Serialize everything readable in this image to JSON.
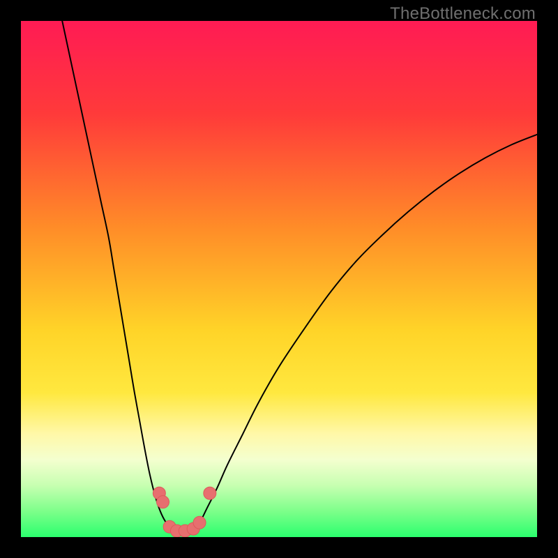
{
  "watermark": "TheBottleneck.com",
  "chart_data": {
    "type": "line",
    "title": "",
    "xlabel": "",
    "ylabel": "",
    "xlim": [
      0,
      100
    ],
    "ylim": [
      0,
      100
    ],
    "gradient_stops": [
      {
        "offset": 0.0,
        "color": "#ff1b54"
      },
      {
        "offset": 0.18,
        "color": "#ff3a3a"
      },
      {
        "offset": 0.4,
        "color": "#ff8c28"
      },
      {
        "offset": 0.6,
        "color": "#ffd428"
      },
      {
        "offset": 0.72,
        "color": "#ffe83f"
      },
      {
        "offset": 0.8,
        "color": "#fff8a8"
      },
      {
        "offset": 0.85,
        "color": "#f4ffcf"
      },
      {
        "offset": 0.9,
        "color": "#c7ffb1"
      },
      {
        "offset": 0.95,
        "color": "#7dff8a"
      },
      {
        "offset": 1.0,
        "color": "#2bff6e"
      }
    ],
    "series": [
      {
        "name": "left-curve",
        "stroke": "#000000",
        "stroke_width": 2,
        "points": [
          {
            "x": 8.0,
            "y": 100.0
          },
          {
            "x": 9.5,
            "y": 93.0
          },
          {
            "x": 11.0,
            "y": 86.0
          },
          {
            "x": 12.5,
            "y": 79.0
          },
          {
            "x": 14.0,
            "y": 72.0
          },
          {
            "x": 15.5,
            "y": 65.0
          },
          {
            "x": 17.0,
            "y": 58.0
          },
          {
            "x": 18.0,
            "y": 52.0
          },
          {
            "x": 19.0,
            "y": 46.0
          },
          {
            "x": 20.0,
            "y": 40.0
          },
          {
            "x": 21.0,
            "y": 34.0
          },
          {
            "x": 22.0,
            "y": 28.0
          },
          {
            "x": 23.0,
            "y": 22.5
          },
          {
            "x": 24.0,
            "y": 17.0
          },
          {
            "x": 25.0,
            "y": 12.0
          },
          {
            "x": 26.0,
            "y": 8.0
          },
          {
            "x": 27.0,
            "y": 5.0
          },
          {
            "x": 28.0,
            "y": 3.0
          },
          {
            "x": 29.0,
            "y": 1.8
          },
          {
            "x": 30.0,
            "y": 1.2
          }
        ]
      },
      {
        "name": "right-curve",
        "stroke": "#000000",
        "stroke_width": 2,
        "points": [
          {
            "x": 33.0,
            "y": 1.2
          },
          {
            "x": 34.0,
            "y": 2.0
          },
          {
            "x": 35.0,
            "y": 3.5
          },
          {
            "x": 36.0,
            "y": 5.5
          },
          {
            "x": 38.0,
            "y": 9.5
          },
          {
            "x": 40.0,
            "y": 14.0
          },
          {
            "x": 43.0,
            "y": 20.0
          },
          {
            "x": 46.0,
            "y": 26.0
          },
          {
            "x": 50.0,
            "y": 33.0
          },
          {
            "x": 55.0,
            "y": 40.5
          },
          {
            "x": 60.0,
            "y": 47.5
          },
          {
            "x": 65.0,
            "y": 53.5
          },
          {
            "x": 70.0,
            "y": 58.5
          },
          {
            "x": 75.0,
            "y": 63.0
          },
          {
            "x": 80.0,
            "y": 67.0
          },
          {
            "x": 85.0,
            "y": 70.5
          },
          {
            "x": 90.0,
            "y": 73.5
          },
          {
            "x": 95.0,
            "y": 76.0
          },
          {
            "x": 100.0,
            "y": 78.0
          }
        ]
      }
    ],
    "highlight_points": {
      "color": "#e76f6f",
      "stroke": "#dd5a5a",
      "radius": 9,
      "points": [
        {
          "x": 26.8,
          "y": 8.5
        },
        {
          "x": 27.5,
          "y": 6.8
        },
        {
          "x": 28.8,
          "y": 2.0
        },
        {
          "x": 30.2,
          "y": 1.2
        },
        {
          "x": 31.8,
          "y": 1.2
        },
        {
          "x": 33.4,
          "y": 1.6
        },
        {
          "x": 34.6,
          "y": 2.8
        },
        {
          "x": 36.6,
          "y": 8.5
        }
      ]
    }
  }
}
